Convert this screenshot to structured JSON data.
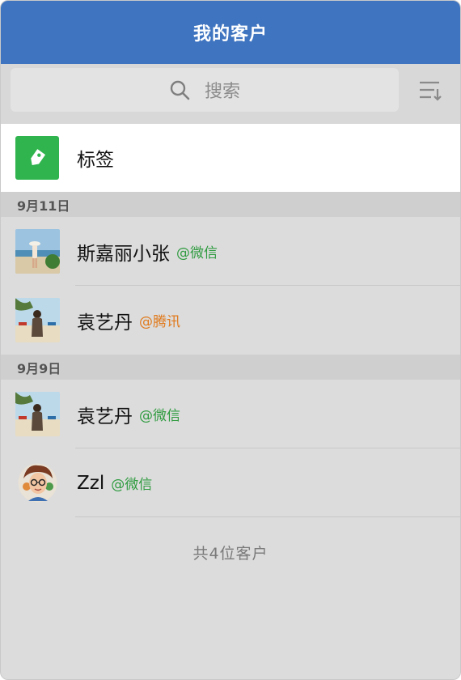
{
  "header": {
    "title": "我的客户"
  },
  "search": {
    "placeholder": "搜索",
    "icon": "search-icon"
  },
  "sort": {
    "icon": "sort-icon"
  },
  "tags": {
    "label": "标签",
    "icon": "tag-icon",
    "color": "#2fb44e"
  },
  "sections": [
    {
      "date": "9月11日",
      "contacts": [
        {
          "name": "斯嘉丽小张",
          "source": "@微信",
          "source_color": "green"
        },
        {
          "name": "袁艺丹",
          "source": "@腾讯",
          "source_color": "orange"
        }
      ]
    },
    {
      "date": "9月9日",
      "contacts": [
        {
          "name": "袁艺丹",
          "source": "@微信",
          "source_color": "green"
        },
        {
          "name": "Zzl",
          "source": "@微信",
          "source_color": "green"
        }
      ]
    }
  ],
  "footer": {
    "count_text": "共4位客户"
  },
  "colors": {
    "header_bg": "#3f74c0",
    "list_bg": "#dcdcdc",
    "wechat_green": "#2e9b3f",
    "tencent_orange": "#e07a1c"
  }
}
